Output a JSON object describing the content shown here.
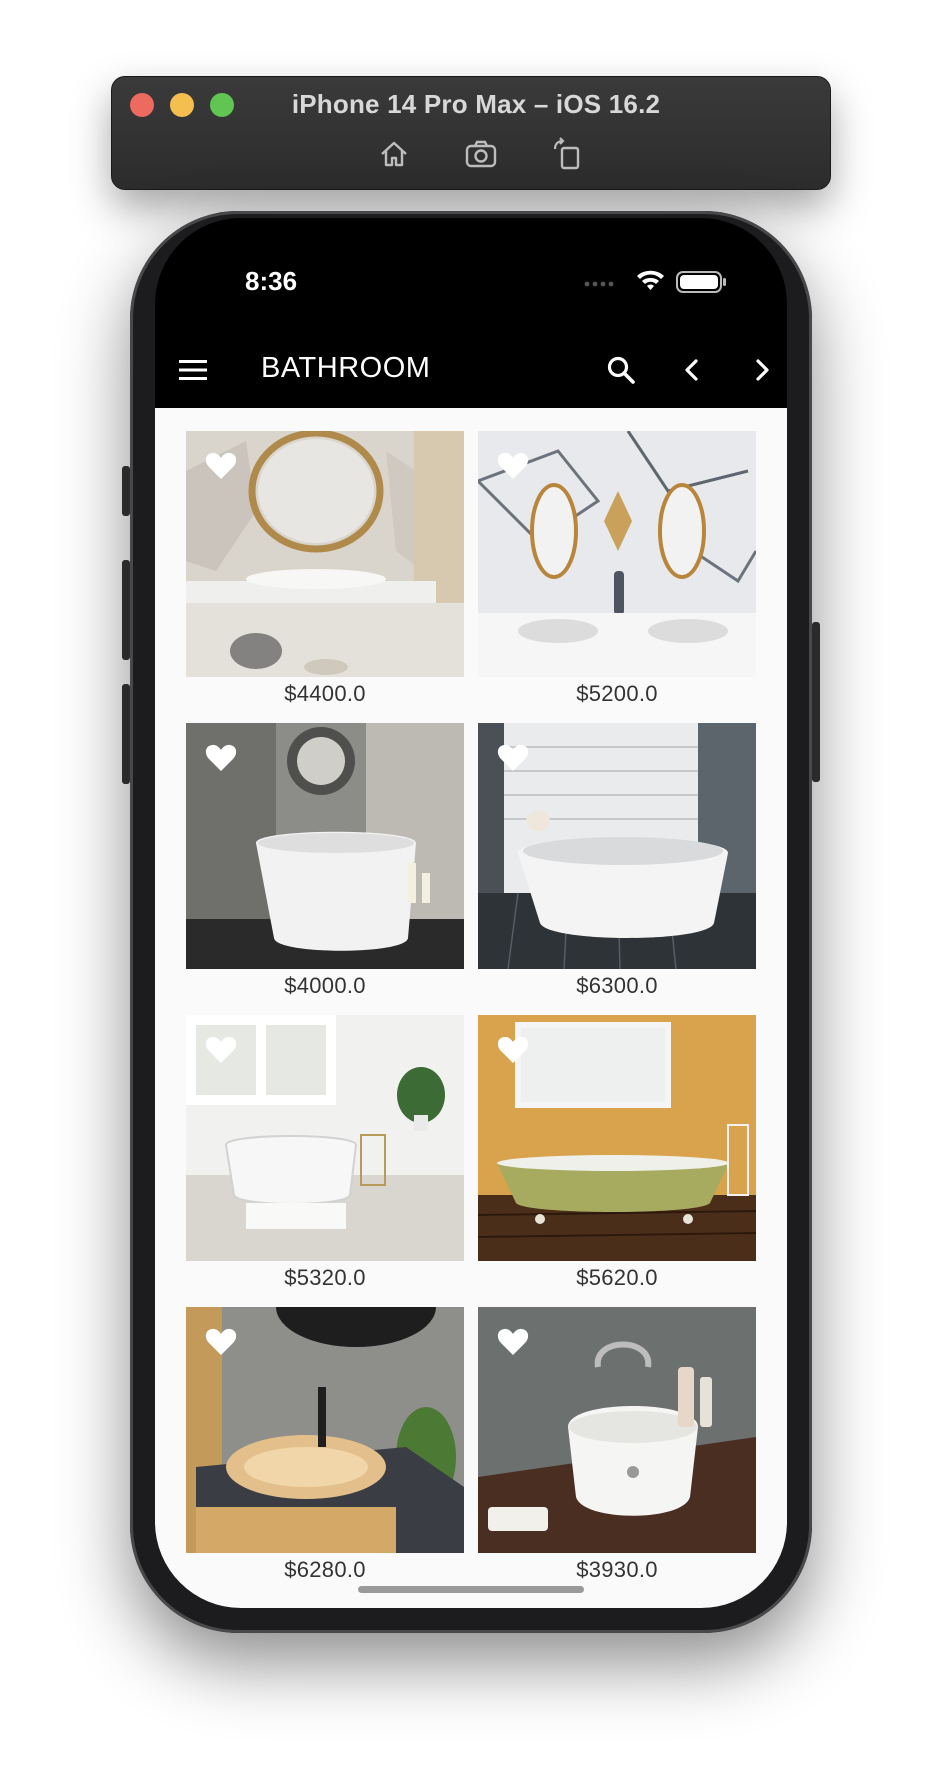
{
  "simulator": {
    "title": "iPhone 14 Pro Max – iOS 16.2",
    "tools": [
      "home-icon",
      "screenshot-icon",
      "rotate-icon"
    ]
  },
  "status_bar": {
    "time": "8:36",
    "icons": [
      "cellular-dots-icon",
      "wifi-icon",
      "battery-icon"
    ]
  },
  "app_bar": {
    "title": "BATHROOM",
    "menu_icon": "menu-icon",
    "actions": [
      "search-icon",
      "chevron-left-icon",
      "chevron-right-icon"
    ]
  },
  "products": [
    {
      "price": "$4400.0",
      "icon": "heart-icon"
    },
    {
      "price": "$5200.0",
      "icon": "heart-icon"
    },
    {
      "price": "$4000.0",
      "icon": "heart-icon"
    },
    {
      "price": "$6300.0",
      "icon": "heart-icon"
    },
    {
      "price": "$5320.0",
      "icon": "heart-icon"
    },
    {
      "price": "$5620.0",
      "icon": "heart-icon"
    },
    {
      "price": "$6280.0",
      "icon": "heart-icon"
    },
    {
      "price": "$3930.0",
      "icon": "heart-icon"
    }
  ],
  "colors": {
    "app_bar": "#000000",
    "content_background": "#fafafa",
    "price_text": "#333333",
    "traffic_red": "#ed6a5e",
    "traffic_yellow": "#f5bf4f",
    "traffic_green": "#61c554"
  }
}
